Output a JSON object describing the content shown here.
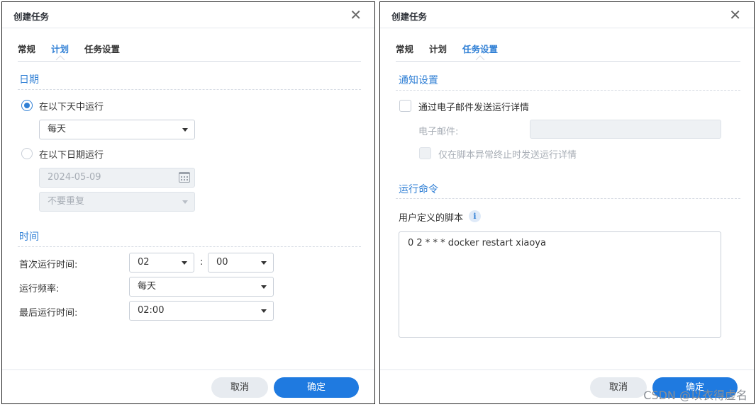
{
  "dialog1": {
    "title": "创建任务",
    "tabs": [
      "常规",
      "计划",
      "任务设置"
    ],
    "active_tab": 1,
    "date_section": "日期",
    "radio_daily": "在以下天中运行",
    "daily_select": "每天",
    "radio_date": "在以下日期运行",
    "date_value": "2024-05-09",
    "repeat_select": "不要重复",
    "time_section": "时间",
    "first_run_label": "首次运行时间:",
    "first_run_hour": "02",
    "colon": ":",
    "first_run_minute": "00",
    "frequency_label": "运行频率:",
    "frequency_value": "每天",
    "last_run_label": "最后运行时间:",
    "last_run_value": "02:00",
    "cancel": "取消",
    "ok": "确定"
  },
  "dialog2": {
    "title": "创建任务",
    "tabs": [
      "常规",
      "计划",
      "任务设置"
    ],
    "active_tab": 2,
    "notify_section": "通知设置",
    "email_checkbox": "通过电子邮件发送运行详情",
    "email_label": "电子邮件:",
    "email_value": "",
    "abnormal_checkbox": "仅在脚本异常终止时发送运行详情",
    "command_section": "运行命令",
    "script_label": "用户定义的脚本",
    "script_text": "0 2 * * * docker restart xiaoya",
    "cancel": "取消",
    "ok": "确定"
  },
  "watermark": "CSDN @以衣得虚名",
  "colors": {
    "accent": "#2f7fd5",
    "primary_button": "#1f7ae0"
  }
}
